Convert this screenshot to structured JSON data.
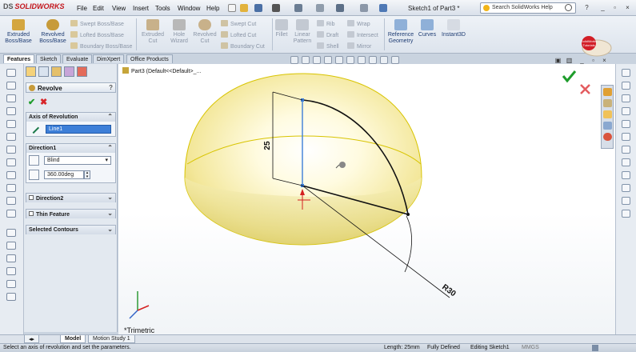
{
  "app": {
    "logo": "SOLIDWORKS",
    "logo_mark": "DS",
    "document_title": "Sketch1 of Part3 *"
  },
  "menu": [
    "File",
    "Edit",
    "View",
    "Insert",
    "Tools",
    "Window",
    "Help"
  ],
  "search": {
    "placeholder": "Search SolidWorks Help"
  },
  "ribbon": {
    "extruded_boss": "Extruded\nBoss/Base",
    "revolved_boss": "Revolved\nBoss/Base",
    "swept_boss": "Swept Boss/Base",
    "lofted_boss": "Lofted Boss/Base",
    "boundary_boss": "Boundary Boss/Base",
    "extruded_cut": "Extruded\nCut",
    "hole_wizard": "Hole\nWizard",
    "revolved_cut": "Revolved\nCut",
    "swept_cut": "Swept Cut",
    "lofted_cut": "Lofted Cut",
    "boundary_cut": "Boundary Cut",
    "fillet": "Fillet",
    "linear_pattern": "Linear\nPattern",
    "rib": "Rib",
    "draft": "Draft",
    "shell": "Shell",
    "wrap": "Wrap",
    "intersect": "Intersect",
    "mirror": "Mirror",
    "reference_geometry": "Reference\nGeometry",
    "curves": "Curves",
    "instant3d": "Instant3D"
  },
  "badge": {
    "line1": "SolidWorks",
    "line2": "Tutorials"
  },
  "tabs": [
    "Features",
    "Sketch",
    "Evaluate",
    "DimXpert",
    "Office Products"
  ],
  "property_manager": {
    "title": "Revolve",
    "help": "?",
    "axis_group": "Axis of Revolution",
    "axis_value": "Line1",
    "direction1_group": "Direction1",
    "end_condition": "Blind",
    "angle": "360.00deg",
    "direction2_group": "Direction2",
    "thin_feature_group": "Thin Feature",
    "selected_contours_group": "Selected Contours"
  },
  "graphics": {
    "tree_label": "Part3  (Default<<Default>_...",
    "dim_vertical": "25",
    "dim_radius": "R30",
    "view_orientation": "*Trimetric"
  },
  "bottom_tabs": [
    "Model",
    "Motion Study 1"
  ],
  "status": {
    "hint": "Select an axis of revolution and set the parameters.",
    "length": "Length: 25mm",
    "defined": "Fully Defined",
    "editing": "Editing Sketch1",
    "units": "MMGS"
  },
  "colors": {
    "accent": "#1e3c73",
    "solid_fill": "#f7efa6",
    "solid_edge": "#d8c400",
    "ok": "#1e9c2b",
    "cancel": "#d8262a"
  }
}
